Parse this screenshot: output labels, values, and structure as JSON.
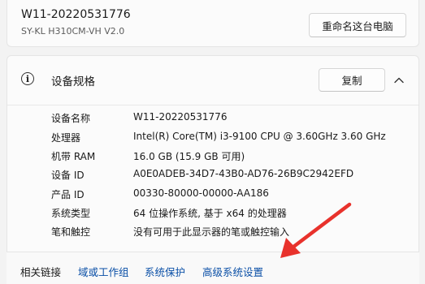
{
  "device": {
    "name": "W11-20220531776",
    "model": "SY-KL H310CM-VH V2.0",
    "rename_button": "重命名这台电脑"
  },
  "specs": {
    "title": "设备规格",
    "copy_button": "复制",
    "rows": [
      {
        "label": "设备名称",
        "value": "W11-20220531776"
      },
      {
        "label": "处理器",
        "value": "Intel(R) Core(TM) i3-9100 CPU @ 3.60GHz   3.60 GHz"
      },
      {
        "label": "机带 RAM",
        "value": "16.0 GB (15.9 GB 可用)"
      },
      {
        "label": "设备 ID",
        "value": "A0E0ADEB-34D7-43B0-AD76-26B9C2942EFD"
      },
      {
        "label": "产品 ID",
        "value": "00330-80000-00000-AA186"
      },
      {
        "label": "系统类型",
        "value": "64 位操作系统, 基于 x64 的处理器"
      },
      {
        "label": "笔和触控",
        "value": "没有可用于此显示器的笔或触控输入"
      }
    ]
  },
  "related_links": {
    "title": "相关链接",
    "links": [
      "域或工作组",
      "系统保护",
      "高级系统设置"
    ]
  },
  "colors": {
    "accent": "#0a4fa6",
    "arrow": "#e8322c"
  }
}
